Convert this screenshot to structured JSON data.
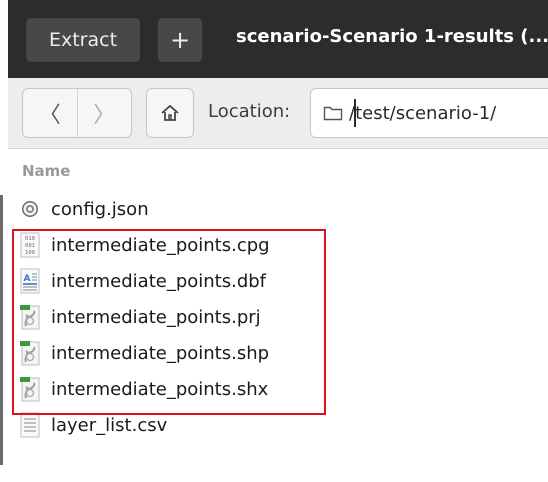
{
  "header": {
    "extract_label": "Extract",
    "add_label": "+",
    "title": "scenario-Scenario 1-results (..."
  },
  "toolbar": {
    "back_label": "〈",
    "forward_label": "〉",
    "location_label": "Location:",
    "location_value": "/test/scenario-1/"
  },
  "list": {
    "column_name": "Name",
    "files": [
      {
        "name": "config.json",
        "icon": "settings-file-icon"
      },
      {
        "name": "intermediate_points.cpg",
        "icon": "binary-file-icon"
      },
      {
        "name": "intermediate_points.dbf",
        "icon": "text-document-icon"
      },
      {
        "name": "intermediate_points.prj",
        "icon": "gis-file-icon"
      },
      {
        "name": "intermediate_points.shp",
        "icon": "gis-file-icon"
      },
      {
        "name": "intermediate_points.shx",
        "icon": "gis-file-icon"
      },
      {
        "name": "layer_list.csv",
        "icon": "plain-text-file-icon"
      }
    ]
  },
  "colors": {
    "header_bg": "#2c2c2c",
    "highlight": "#d9141f"
  }
}
